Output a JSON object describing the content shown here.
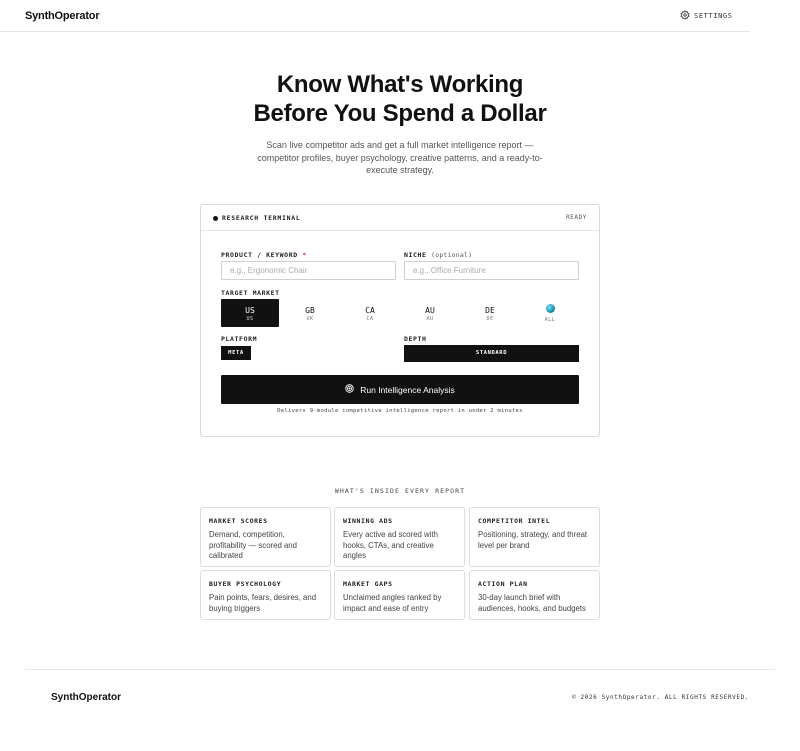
{
  "header": {
    "brand": "SynthOperator",
    "settings_label": "SETTINGS",
    "settings_icon": "gear-icon"
  },
  "hero": {
    "title_line1": "Know What's Working",
    "title_line2": "Before You Spend a Dollar",
    "subtitle": "Scan live competitor ads and get a full market intelligence report — competitor profiles, buyer psychology, creative patterns, and a ready-to-execute strategy."
  },
  "terminal": {
    "title": "RESEARCH TERMINAL",
    "status": "READY",
    "product_label": "PRODUCT / KEYWORD",
    "product_required": "*",
    "product_placeholder": "e.g., Ergonomic Chair",
    "product_value": "",
    "niche_label": "NICHE",
    "niche_optional": "(optional)",
    "niche_placeholder": "e.g., Office Furniture",
    "niche_value": "",
    "market_label": "TARGET MARKET",
    "markets": [
      {
        "code": "US",
        "sub": "US",
        "selected": true
      },
      {
        "code": "GB",
        "sub": "UK",
        "selected": false
      },
      {
        "code": "CA",
        "sub": "CA",
        "selected": false
      },
      {
        "code": "AU",
        "sub": "AU",
        "selected": false
      },
      {
        "code": "DE",
        "sub": "DE",
        "selected": false
      },
      {
        "code": "",
        "sub": "ALL",
        "icon": "globe-icon",
        "selected": false
      }
    ],
    "platform_label": "PLATFORM",
    "platform_value": "META",
    "depth_label": "DEPTH",
    "depth_value": "STANDARD",
    "run_label": "Run Intelligence Analysis",
    "run_icon": "target-icon",
    "note": "Delivers 9-module competitive intelligence report in under 2 minutes"
  },
  "features": {
    "section_title": "WHAT'S INSIDE EVERY REPORT",
    "items": [
      {
        "title": "MARKET SCORES",
        "desc": "Demand, competition, profitability — scored and calibrated"
      },
      {
        "title": "WINNING ADS",
        "desc": "Every active ad scored with hooks, CTAs, and creative angles"
      },
      {
        "title": "COMPETITOR INTEL",
        "desc": "Positioning, strategy, and threat level per brand"
      },
      {
        "title": "BUYER PSYCHOLOGY",
        "desc": "Pain points, fears, desires, and buying triggers"
      },
      {
        "title": "MARKET GAPS",
        "desc": "Unclaimed angles ranked by impact and ease of entry"
      },
      {
        "title": "ACTION PLAN",
        "desc": "30-day launch brief with audiences, hooks, and budgets"
      }
    ]
  },
  "footer": {
    "brand": "SynthOperator",
    "copyright": "© 2026 SynthOperator. ALL RIGHTS RESERVED."
  },
  "colors": {
    "accent": "#111111",
    "required": "#dd3333",
    "border": "#d9d9d9"
  }
}
